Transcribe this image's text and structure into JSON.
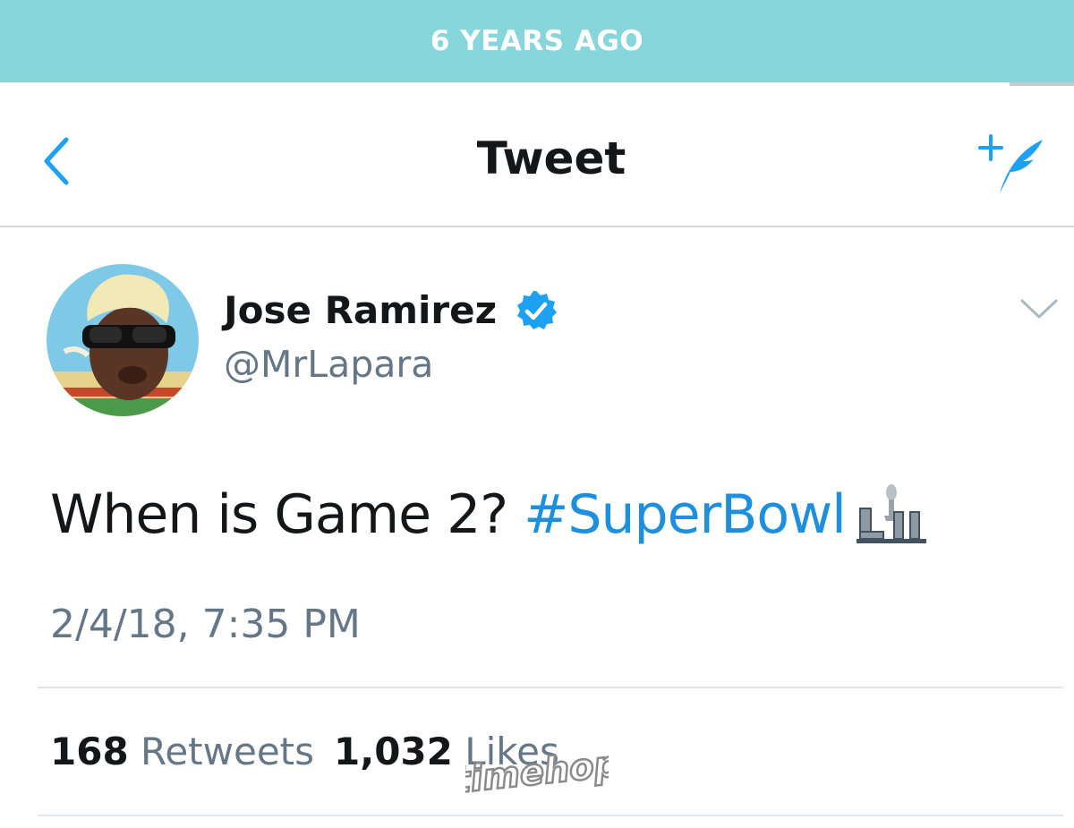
{
  "banner": {
    "label": "6 YEARS AGO",
    "color": "#86d6dc"
  },
  "nav": {
    "title": "Tweet",
    "back_icon": "chevron-left-icon",
    "compose_icon": "compose-tweet-icon"
  },
  "tweet": {
    "author": {
      "name": "Jose Ramirez",
      "handle": "@MrLapara",
      "verified": true
    },
    "text": "When is Game 2? ",
    "hashtag": "#SuperBowl",
    "hashtag_emoji": "super-bowl-lii-logo-icon",
    "timestamp": "2/4/18, 7:35 PM",
    "retweets_count": "168",
    "retweets_label": "Retweets",
    "likes_count": "1,032",
    "likes_label": "Likes"
  },
  "watermark": {
    "text": "timehop"
  },
  "colors": {
    "link": "#1d8fdc",
    "secondary_text": "#657786",
    "primary_text": "#14171a",
    "verified_badge": "#1da1f2"
  }
}
